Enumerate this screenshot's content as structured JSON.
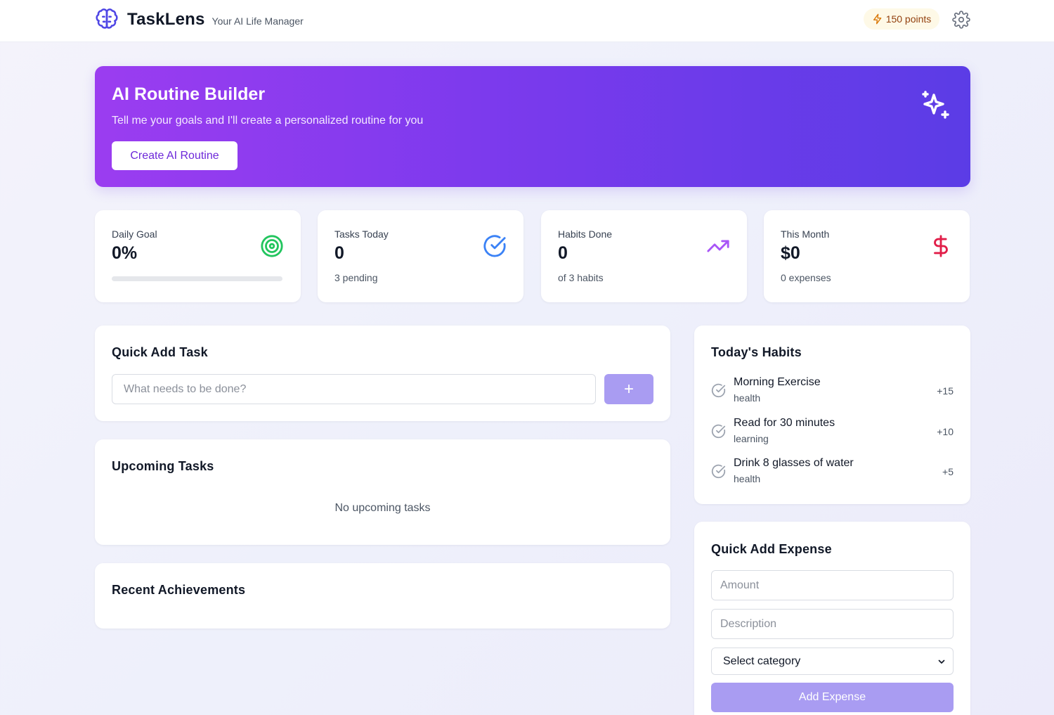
{
  "header": {
    "app_name": "TaskLens",
    "tagline": "Your AI Life Manager",
    "points": "150 points",
    "icons": {
      "logo": "brain-icon",
      "points": "bolt-icon",
      "settings": "gear-icon"
    }
  },
  "hero": {
    "title": "AI Routine Builder",
    "subtitle": "Tell me your goals and I'll create a personalized routine for you",
    "button_label": "Create AI Routine",
    "icon": "sparkles-icon"
  },
  "stats": [
    {
      "label": "Daily Goal",
      "value": "0%",
      "progress": 0,
      "icon": "target-icon",
      "icon_color": "#22c55e"
    },
    {
      "label": "Tasks Today",
      "value": "0",
      "sub": "3 pending",
      "icon": "check-circle-icon",
      "icon_color": "#3b82f6"
    },
    {
      "label": "Habits Done",
      "value": "0",
      "sub": "of 3 habits",
      "icon": "trending-up-icon",
      "icon_color": "#a855f7"
    },
    {
      "label": "This Month",
      "value": "$0",
      "sub": "0 expenses",
      "icon": "dollar-icon",
      "icon_color": "#e11d48"
    }
  ],
  "quick_add_task": {
    "title": "Quick Add Task",
    "placeholder": "What needs to be done?",
    "button_label": "+"
  },
  "upcoming_tasks": {
    "title": "Upcoming Tasks",
    "empty_text": "No upcoming tasks"
  },
  "recent_achievements": {
    "title": "Recent Achievements"
  },
  "habits": {
    "title": "Today's Habits",
    "items": [
      {
        "name": "Morning Exercise",
        "category": "health",
        "points": "+15"
      },
      {
        "name": "Read for 30 minutes",
        "category": "learning",
        "points": "+10"
      },
      {
        "name": "Drink 8 glasses of water",
        "category": "health",
        "points": "+5"
      }
    ]
  },
  "quick_add_expense": {
    "title": "Quick Add Expense",
    "amount_placeholder": "Amount",
    "description_placeholder": "Description",
    "category_selected": "Select category",
    "button_label": "Add Expense"
  },
  "colors": {
    "accent": "#7c3aed",
    "button_soft": "#a99cf2",
    "points_bg": "#fef9e7"
  }
}
